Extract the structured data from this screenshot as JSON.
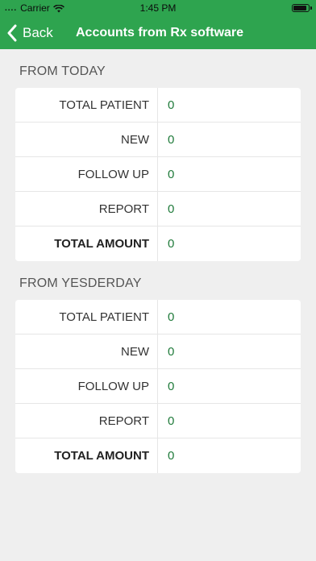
{
  "status_bar": {
    "signal_dots": "....",
    "carrier": "Carrier",
    "time": "1:45 PM"
  },
  "nav": {
    "back_label": "Back",
    "title": "Accounts from Rx software"
  },
  "colors": {
    "accent": "#2ea44f",
    "value_text": "#1f7a3a",
    "background": "#efefef"
  },
  "sections": [
    {
      "header": "FROM TODAY",
      "rows": [
        {
          "label": "TOTAL PATIENT",
          "value": "0"
        },
        {
          "label": "NEW",
          "value": "0"
        },
        {
          "label": "FOLLOW UP",
          "value": "0"
        },
        {
          "label": "REPORT",
          "value": "0"
        },
        {
          "label": "TOTAL AMOUNT",
          "value": "0"
        }
      ]
    },
    {
      "header": "FROM YESDERDAY",
      "rows": [
        {
          "label": "TOTAL PATIENT",
          "value": "0"
        },
        {
          "label": "NEW",
          "value": "0"
        },
        {
          "label": "FOLLOW UP",
          "value": "0"
        },
        {
          "label": "REPORT",
          "value": "0"
        },
        {
          "label": "TOTAL AMOUNT",
          "value": "0"
        }
      ]
    }
  ]
}
